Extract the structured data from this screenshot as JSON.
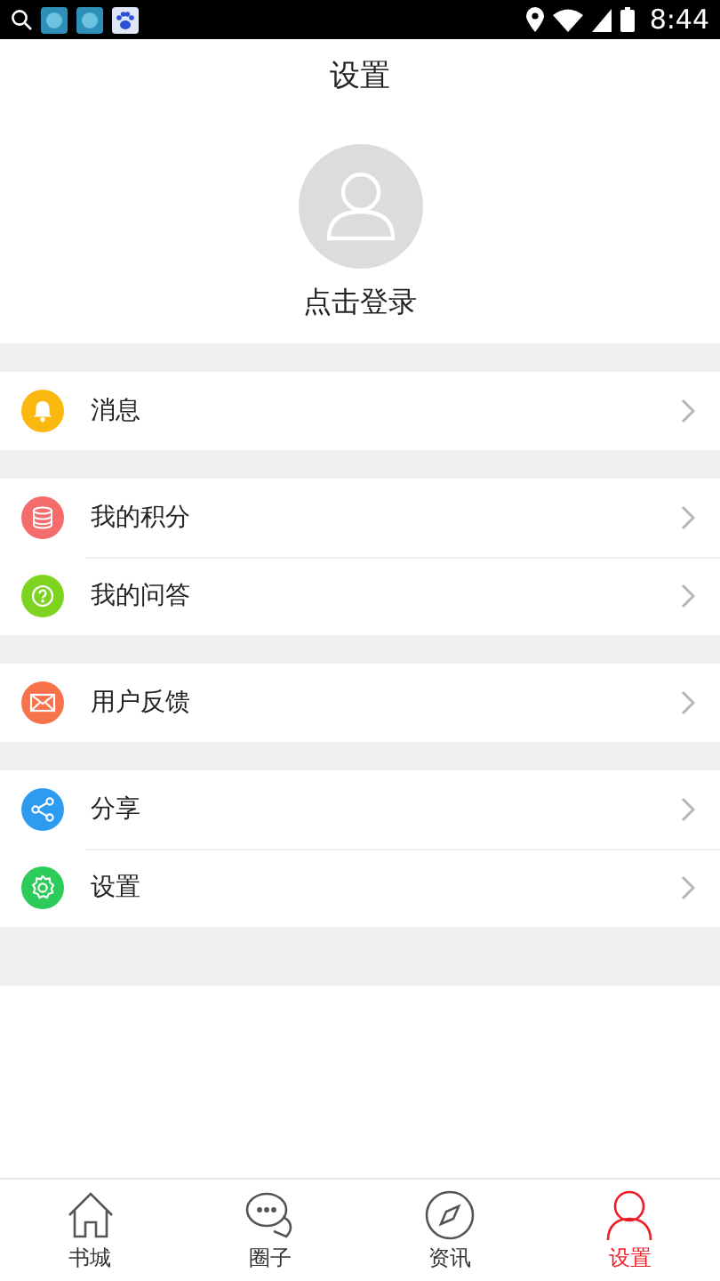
{
  "status_bar": {
    "time": "8:44"
  },
  "title": "设置",
  "profile": {
    "login_label": "点击登录"
  },
  "groups": [
    [
      {
        "label": "消息",
        "kind": "bell",
        "color": "#fbb80f"
      }
    ],
    [
      {
        "label": "我的积分",
        "kind": "coins",
        "color": "#f56c6c"
      },
      {
        "label": "我的问答",
        "kind": "question",
        "color": "#7ed321"
      }
    ],
    [
      {
        "label": "用户反馈",
        "kind": "mail",
        "color": "#f7734b"
      }
    ],
    [
      {
        "label": "分享",
        "kind": "share",
        "color": "#2d9cf0"
      },
      {
        "label": "设置",
        "kind": "gear",
        "color": "#2dcb5a"
      }
    ]
  ],
  "tabs": [
    {
      "label": "书城",
      "kind": "home",
      "selected": false
    },
    {
      "label": "圈子",
      "kind": "chat",
      "selected": false
    },
    {
      "label": "资讯",
      "kind": "compass",
      "selected": false
    },
    {
      "label": "设置",
      "kind": "person",
      "selected": true
    }
  ]
}
